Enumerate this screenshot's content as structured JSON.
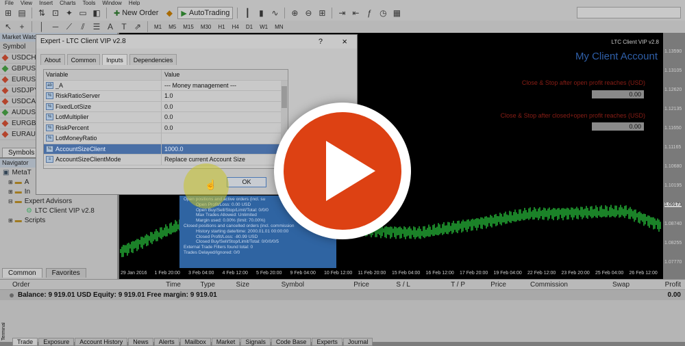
{
  "toolbar": {
    "top_menu": [
      "File",
      "View",
      "Insert",
      "Charts",
      "Tools",
      "Window",
      "Help"
    ],
    "new_order_label": "New Order",
    "autotrading_label": "AutoTrading",
    "timeframes": [
      "M1",
      "M5",
      "M15",
      "M30",
      "H1",
      "H4",
      "D1",
      "W1",
      "MN"
    ],
    "search_placeholder": ""
  },
  "market_watch": {
    "title": "Market Watch",
    "column": "Symbol",
    "symbols": [
      {
        "name": "USDCH",
        "color": "#b4442c"
      },
      {
        "name": "GBPUSI",
        "color": "#3d8a3b"
      },
      {
        "name": "EURUSI",
        "color": "#b4442c"
      },
      {
        "name": "USDJPY",
        "color": "#b4442c"
      },
      {
        "name": "USDCA",
        "color": "#b4442c"
      },
      {
        "name": "AUDUS",
        "color": "#3d8a3b"
      },
      {
        "name": "EURGBI",
        "color": "#b4442c"
      },
      {
        "name": "EURAUI",
        "color": "#b4442c"
      }
    ],
    "tab_symbols": "Symbols"
  },
  "navigator": {
    "title": "Navigator",
    "items": [
      {
        "label": "MetaT",
        "icon": "terminal-icon"
      },
      {
        "label": "A",
        "icon": "folder-icon"
      },
      {
        "label": "In",
        "icon": "folder-icon"
      },
      {
        "label": "Expert Advisors",
        "icon": "folder-icon"
      },
      {
        "label": "LTC Client VIP v2.8",
        "icon": "expert-icon"
      },
      {
        "label": "Scripts",
        "icon": "folder-icon"
      }
    ],
    "tabs": [
      "Common",
      "Favorites"
    ]
  },
  "chart": {
    "title_small": "LTC Client VIP v2.8",
    "account_title": "My Client Account",
    "label1": "Close & Stop after open profit reaches (USD)",
    "value1": "0.00",
    "label2": "Close & Stop after closed+open profit reaches (USD)",
    "value2": "0.00",
    "price_labels": [
      "1.13590",
      "1.13105",
      "1.12620",
      "1.12135",
      "1.11650",
      "1.11165",
      "1.10680",
      "1.10195",
      "1.09173",
      "1.08740",
      "1.08255",
      "1.07770"
    ],
    "date_labels": [
      "29 Jan 2016",
      "1 Feb 20:00",
      "3 Feb 04:00",
      "4 Feb 12:00",
      "5 Feb 20:00",
      "9 Feb 04:00",
      "10 Feb 12:00",
      "11 Feb 20:00",
      "15 Feb 04:00",
      "16 Feb 12:00",
      "17 Feb 20:00",
      "19 Feb 04:00",
      "22 Feb 12:00",
      "23 Feb 20:00",
      "25 Feb 04:00",
      "26 Feb 12:00"
    ],
    "accent_color": "#2f5fa8",
    "text_red": "#8b1e16"
  },
  "dialog": {
    "title": "Expert - LTC Client VIP v2.8",
    "help": "?",
    "close": "×",
    "tabs": [
      "About",
      "Common",
      "Inputs",
      "Dependencies"
    ],
    "columns": [
      "Variable",
      "Value"
    ],
    "rows": [
      {
        "var": "_A",
        "val": "--- Money management ---",
        "icon": "ab"
      },
      {
        "var": "RiskRatioServer",
        "val": "1.0",
        "icon": "%"
      },
      {
        "var": "FixedLotSize",
        "val": "0.0",
        "icon": "%"
      },
      {
        "var": "LotMultiplier",
        "val": "0.0",
        "icon": "%"
      },
      {
        "var": "RiskPercent",
        "val": "0.0",
        "icon": "%"
      },
      {
        "var": "LotMoneyRatio",
        "val": "",
        "icon": "%"
      },
      {
        "var": "AccountSizeClient",
        "val": "1000.0",
        "icon": "%"
      },
      {
        "var": "AccountSizeClientMode",
        "val": "Replace current Account Size",
        "icon": "≡"
      }
    ],
    "ok_label": "OK"
  },
  "report": {
    "lines": [
      "Open positions and active orders (incl. su",
      "Open Profit/Loss: 0.00 USD",
      "Open Buy/Sell/Stop/Limit/Total: 0/0/0",
      "Max Trades Allowed: Unlimited",
      "Margin used: 0.00% (limit: 70.00%)",
      "Closed positions and cancelled orders (incl. commission",
      "History starting date/time: 2000.01.01 00:00:00",
      "Closed Profit/Loss: -80.99 USD",
      "Closed Buy/Sell/Stop/Limit/Total: 0/0/0/0/5",
      "External Trade Filters found total: 0",
      "Trades Delayed/Ignored: 0/0"
    ]
  },
  "terminal": {
    "columns": [
      "Order",
      "Time",
      "Type",
      "Size",
      "Symbol",
      "Price",
      "S / L",
      "T / P",
      "Price",
      "Commission",
      "Swap",
      "Profit"
    ],
    "balance_line": "Balance: 9 919.01 USD  Equity: 9 919.01  Free margin: 9 919.01",
    "profit_total": "0.00",
    "side_label": "Terminal",
    "tabs": [
      "Trade",
      "Exposure",
      "Account History",
      "News",
      "Alerts",
      "Mailbox",
      "Market",
      "Signals",
      "Code Base",
      "Experts",
      "Journal"
    ]
  },
  "video": {
    "play_color": "#dd4113"
  }
}
